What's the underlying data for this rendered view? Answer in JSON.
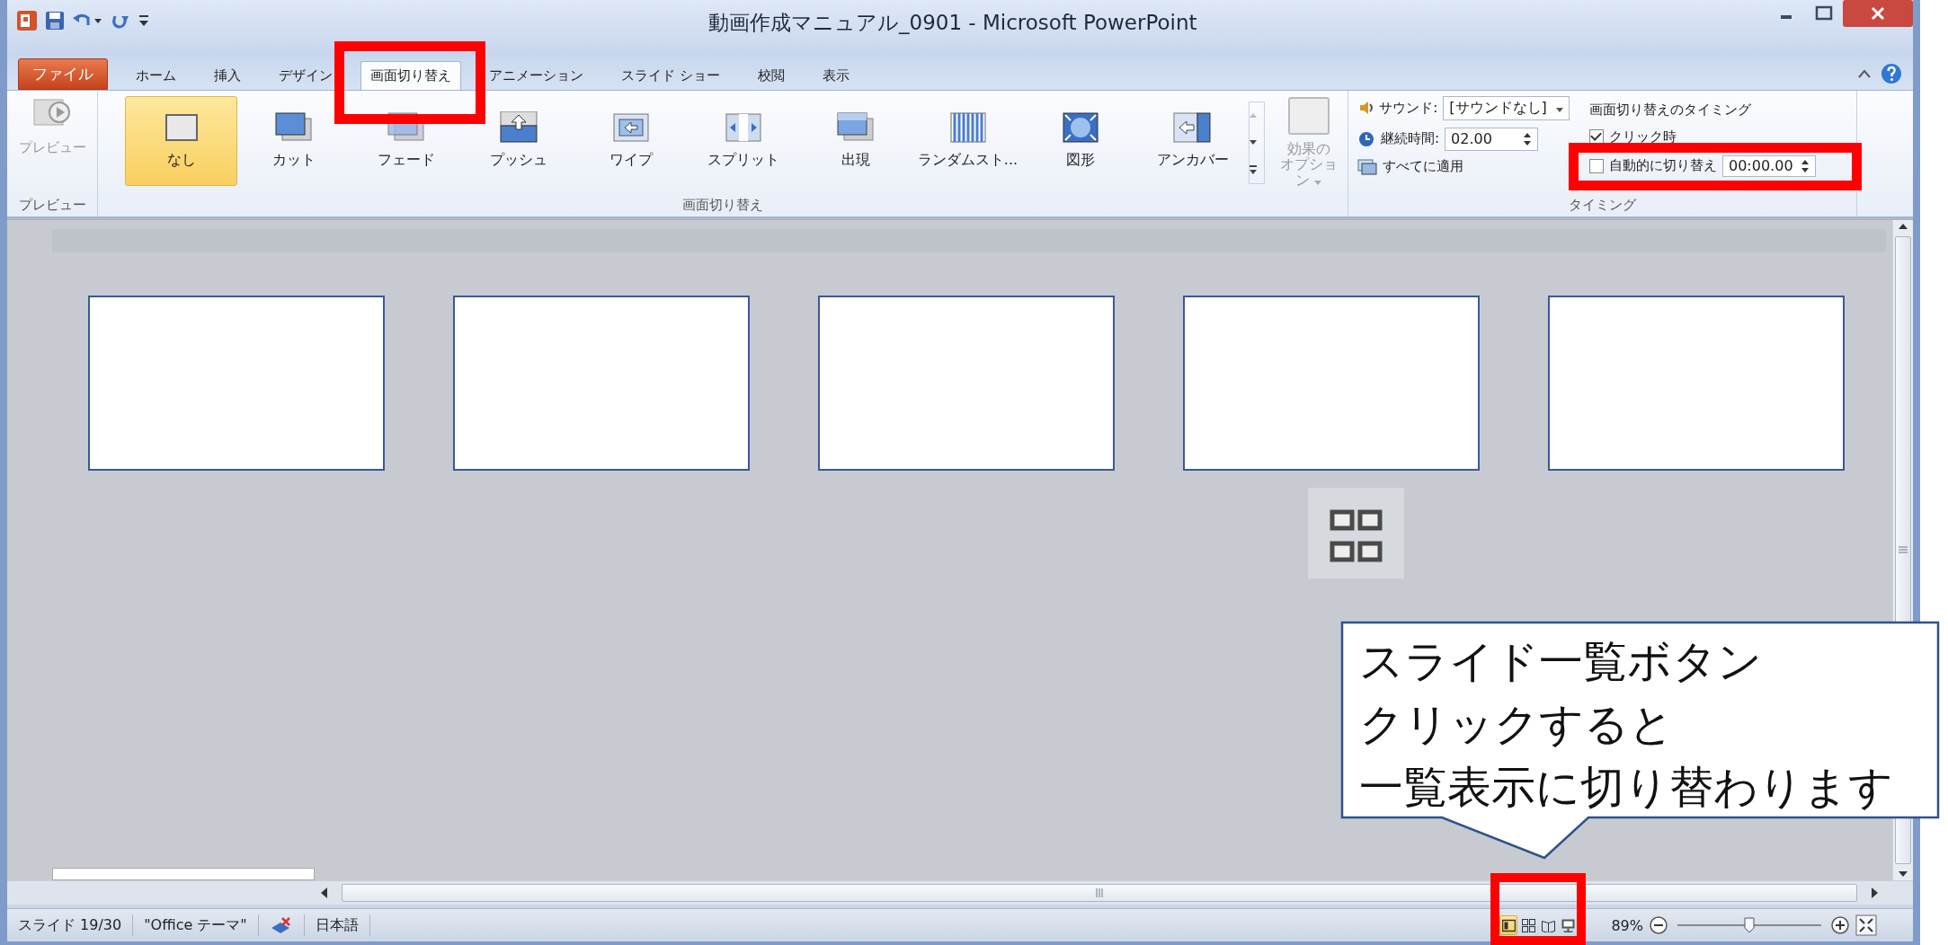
{
  "window": {
    "title": "動画作成マニュアル_0901 - Microsoft PowerPoint"
  },
  "file_tab": "ファイル",
  "tabs": [
    {
      "label": "ホーム",
      "selected": false
    },
    {
      "label": "挿入",
      "selected": false
    },
    {
      "label": "デザイン",
      "selected": false
    },
    {
      "label": "画面切り替え",
      "selected": true
    },
    {
      "label": "アニメーション",
      "selected": false
    },
    {
      "label": "スライド ショー",
      "selected": false
    },
    {
      "label": "校閲",
      "selected": false
    },
    {
      "label": "表示",
      "selected": false
    }
  ],
  "ribbon": {
    "preview": {
      "label": "プレビュー",
      "group": "プレビュー"
    },
    "transitions": {
      "items": [
        {
          "label": "なし",
          "selected": true
        },
        {
          "label": "カット",
          "selected": false
        },
        {
          "label": "フェード",
          "selected": false
        },
        {
          "label": "プッシュ",
          "selected": false
        },
        {
          "label": "ワイプ",
          "selected": false
        },
        {
          "label": "スプリット",
          "selected": false
        },
        {
          "label": "出現",
          "selected": false
        },
        {
          "label": "ランダムスト...",
          "selected": false
        },
        {
          "label": "図形",
          "selected": false
        },
        {
          "label": "アンカバー",
          "selected": false
        }
      ],
      "effect_options": [
        "効果の",
        "オプション"
      ],
      "group": "画面切り替え"
    },
    "timing": {
      "sound_label": "サウンド:",
      "sound_value": "[サウンドなし]",
      "duration_label": "継続時間:",
      "duration_value": "02.00",
      "apply_all": "すべてに適用",
      "heading": "画面切り替えのタイミング",
      "on_click": {
        "label": "クリック時",
        "checked": true
      },
      "auto_advance": {
        "label": "自動的に切り替え",
        "checked": false,
        "value": "00:00.00"
      },
      "group": "タイミング"
    }
  },
  "slides": [
    {
      "kind": "blank"
    },
    {
      "kind": "blank"
    },
    {
      "kind": "blank"
    },
    {
      "kind": "blank"
    },
    {
      "kind": "blank"
    }
  ],
  "callout": {
    "lines": [
      "スライド一覧ボタン",
      "クリックすると",
      "一覧表示に切り替わります"
    ]
  },
  "status_bar": {
    "slide": "スライド 19/30",
    "theme": "\"Office テーマ\"",
    "language": "日本語",
    "views": [
      {
        "selected": true
      },
      {
        "selected": false
      },
      {
        "selected": false
      },
      {
        "selected": false
      }
    ],
    "zoom": "89%",
    "zoom_slider": {
      "level": 0.5
    }
  }
}
